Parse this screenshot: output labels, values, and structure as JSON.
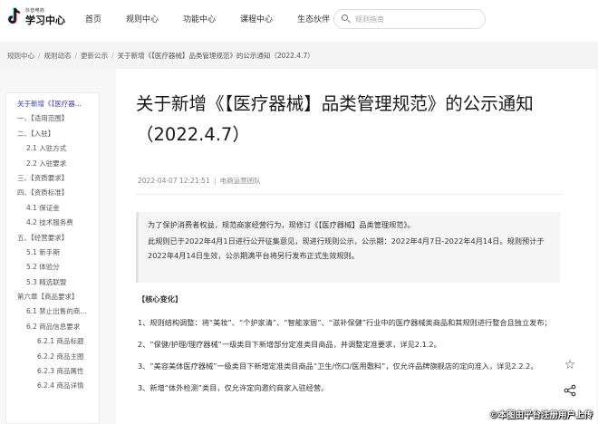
{
  "header": {
    "logo_small": "抖音电商",
    "logo_big": "学习中心",
    "nav": [
      {
        "label": "首页"
      },
      {
        "label": "规则中心"
      },
      {
        "label": "功能中心"
      },
      {
        "label": "课程中心"
      },
      {
        "label": "生态伙伴"
      }
    ],
    "search_placeholder": "规则指南"
  },
  "breadcrumb": [
    "规则中心",
    "规则动态",
    "更新公示",
    "关于新增《【医疗器械】品类管理规范》的公示通知（2022.4.7）"
  ],
  "toc": [
    {
      "label": "关于新增《【医疗器...",
      "level": 0,
      "active": true
    },
    {
      "label": "一、【适用范围】",
      "level": 0
    },
    {
      "label": "二、【入驻】",
      "level": 0
    },
    {
      "label": "2.1 入驻方式",
      "level": 1
    },
    {
      "label": "2.2 入驻要求",
      "level": 1
    },
    {
      "label": "三、【资质要求】",
      "level": 0
    },
    {
      "label": "四、【资质标准】",
      "level": 0
    },
    {
      "label": "4.1 保证金",
      "level": 1
    },
    {
      "label": "4.2 技术服务费",
      "level": 1
    },
    {
      "label": "五、【经营要求】",
      "level": 0
    },
    {
      "label": "5.1 新手期",
      "level": 1
    },
    {
      "label": "5.2 体验分",
      "level": 1
    },
    {
      "label": "5.3 精选联盟",
      "level": 1
    },
    {
      "label": "第六章【商品要求】",
      "level": 0
    },
    {
      "label": "6.1 禁止出售的商...",
      "level": 1
    },
    {
      "label": "6.2 商品信息要求",
      "level": 1
    },
    {
      "label": "6.2.1 商品标题",
      "level": 2
    },
    {
      "label": "6.2.2 商品主图",
      "level": 2
    },
    {
      "label": "6.2.3 商品属性",
      "level": 2
    },
    {
      "label": "6.2.4 商品详情",
      "level": 2
    }
  ],
  "article": {
    "title": "关于新增《【医疗器械】品类管理规范》的公示通知（2022.4.7）",
    "date": "2022-04-07 12:21:51",
    "author": "电商运营团队",
    "quote": [
      "为了保护消费者权益，规范商家经营行为，现修订《【医疗器械】品类管理规范》。",
      "此规则已于2022年4月1日进行公开征集意见，现进行规则公示，公示期：2022年4月7日-2022年4月14日。规则预计于2022年4月14日生效，公示期满平台将另行发布正式生效规则。"
    ],
    "section_heading": "【核心变化】",
    "points": [
      "1、规则结构调整：将“美妆”、“个护家清”、“智能家居”、“滋补保健”行业中的医疗器械类商品和其规则进行整合且独立发布；",
      "2、“保健/护理/理疗器械”一级类目下新增部分定准类目商品，并调整定准要求，详见2.1.2。",
      "3、“美容美体医疗器械”一级类目下新增定准类目商品“卫生/伤口/医用敷料”，仅允许品牌旗舰店的定向准入，详见2.2.2。",
      "3、新增“体外检测”类目，仅允许定向邀约商家入驻经营。"
    ]
  },
  "actions": {
    "star_icon": "☆",
    "share_icon": "⋖"
  },
  "watermark": "©本图由平台注册用户上传",
  "colors": {
    "toc_active": "#3a3aa8",
    "logo_cyan": "#25f4ee",
    "logo_red": "#fe2c55"
  }
}
